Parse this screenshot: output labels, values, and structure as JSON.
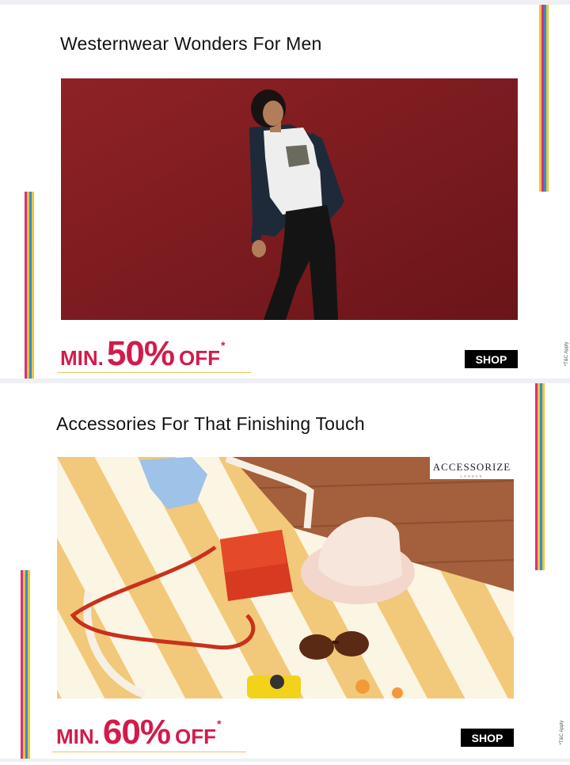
{
  "banners": [
    {
      "title": "Westernwear Wonders For Men",
      "offer": {
        "prefix": "MIN.",
        "percent": "50%",
        "suffix": "OFF",
        "asterisk": "*"
      },
      "shop_label": "SHOP",
      "tc_label": "*T&C Apply"
    },
    {
      "title": "Accessories For That Finishing Touch",
      "brand": {
        "name": "ACCESSORIZE",
        "sub": "LONDON"
      },
      "offer": {
        "prefix": "MIN.",
        "percent": "60%",
        "suffix": "OFF",
        "asterisk": "*"
      },
      "shop_label": "SHOP",
      "tc_label": "*T&C Apply"
    }
  ],
  "colors": {
    "offer": "#d31b4b",
    "stripe_yellow": "#f2c33a",
    "stripe_pink": "#d8307a",
    "stripe_blue": "#2e8fd1",
    "button_bg": "#000000"
  }
}
